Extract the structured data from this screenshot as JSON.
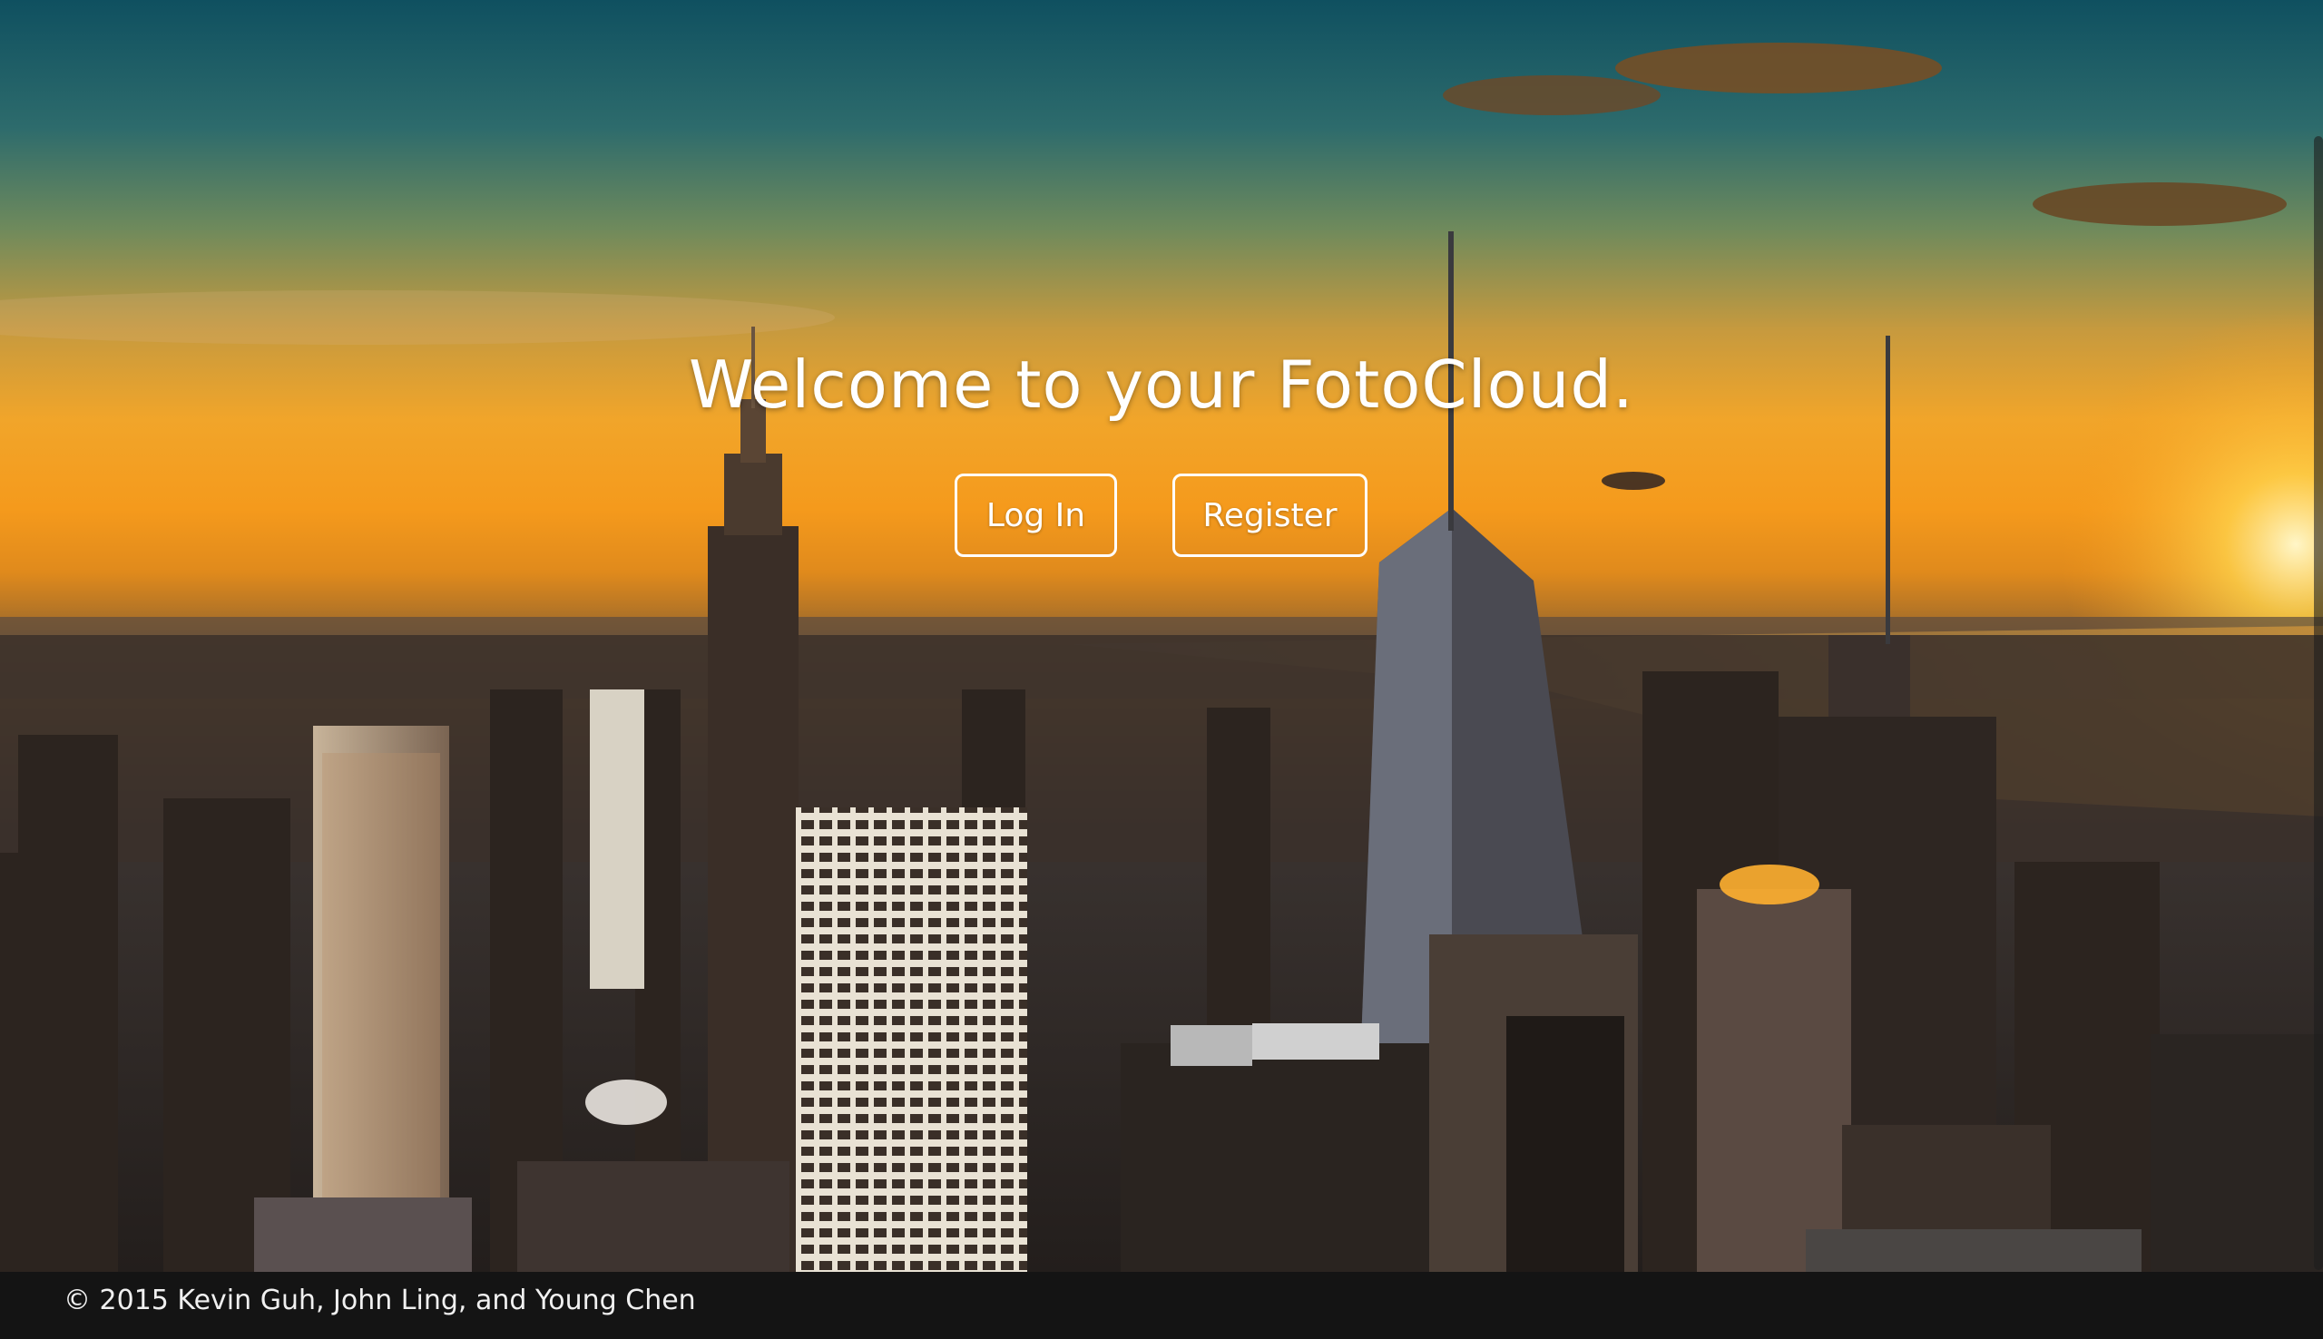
{
  "hero": {
    "welcome_text": "Welcome to your FotoCloud.",
    "background_description": "sunset-city-skyline"
  },
  "actions": {
    "login_label": "Log In",
    "register_label": "Register"
  },
  "footer": {
    "copyright": "© 2015 Kevin Guh, John Ling, and Young Chen"
  },
  "colors": {
    "text": "#ffffff",
    "footer_bg": "#141414",
    "sky_top": "#0f5060",
    "sunset": "#f59a1c"
  }
}
